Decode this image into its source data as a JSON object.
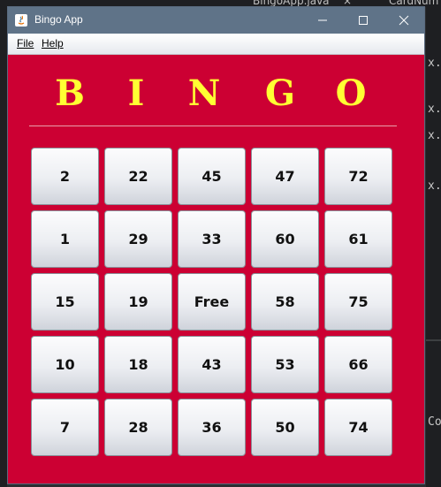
{
  "window": {
    "title": "Bingo App",
    "minimize_icon": "minimize-icon",
    "maximize_icon": "maximize-icon",
    "close_icon": "close-icon"
  },
  "background": {
    "tab1": "BingoApp.java",
    "tab2": "CardNum",
    "close_glyph": "×",
    "frag_x": "x.",
    "frag_co": "Co"
  },
  "menu": {
    "file": "File",
    "help": "Help"
  },
  "letters": [
    "B",
    "I",
    "N",
    "G",
    "O"
  ],
  "grid": [
    [
      "2",
      "22",
      "45",
      "47",
      "72"
    ],
    [
      "1",
      "29",
      "33",
      "60",
      "61"
    ],
    [
      "15",
      "19",
      "Free",
      "58",
      "75"
    ],
    [
      "10",
      "18",
      "43",
      "53",
      "66"
    ],
    [
      "7",
      "28",
      "36",
      "50",
      "74"
    ]
  ],
  "colors": {
    "board": "#cc0033",
    "letters": "#ffff33",
    "titlebar": "#5f7388"
  }
}
